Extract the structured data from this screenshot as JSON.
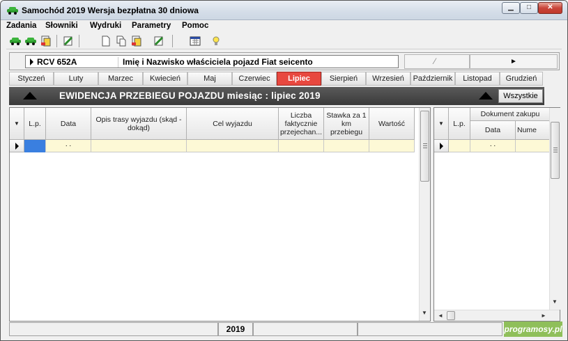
{
  "window": {
    "title": "Samochód 2019 Wersja bezpłatna 30 dniowa",
    "min_glyph": "▁",
    "max_glyph": "□",
    "close_glyph": "✕"
  },
  "menu": [
    "Zadania",
    "Słowniki",
    "Wydruki",
    "Parametry",
    "Pomoc"
  ],
  "vehicle": {
    "registration": "RCV 652A",
    "owner_model": "Imię i Nazwisko właściciela pojazd Fiat  seicento",
    "btn1_glyph": "⁄",
    "btn2_glyph": "►"
  },
  "months": [
    "Styczeń",
    "Luty",
    "Marzec",
    "Kwiecień",
    "Maj",
    "Czerwiec",
    "Lipiec",
    "Sierpień",
    "Wrzesień",
    "Październik",
    "Listopad",
    "Grudzień"
  ],
  "active_month_index": 6,
  "band": {
    "title": "EWIDENCJA PRZEBIEGU POJAZDU miesiąc : lipiec 2019",
    "all_button": "Wszystkie"
  },
  "main_grid": {
    "columns": [
      "L.p.",
      "Data",
      "Opis trasy wyjazdu (skąd - dokąd)",
      "Cel wyjazdu",
      "Liczba faktycznie przejechan...",
      "Stawka za 1 km przebiegu",
      "Wartość"
    ],
    "row": {
      "data": ". ."
    }
  },
  "side_grid": {
    "columns": [
      "L.p."
    ],
    "group_header": "Dokument zakupu",
    "sub_columns": [
      "Data",
      "Nume"
    ],
    "row": {
      "data": ". ."
    }
  },
  "status": {
    "year": "2019"
  },
  "watermark": "programosy.pl",
  "colors": {
    "active_month": "#e8483f",
    "row_bg": "#fdf9d6",
    "selected_cell": "#3a7fe0",
    "band": "#4a4a4a"
  }
}
